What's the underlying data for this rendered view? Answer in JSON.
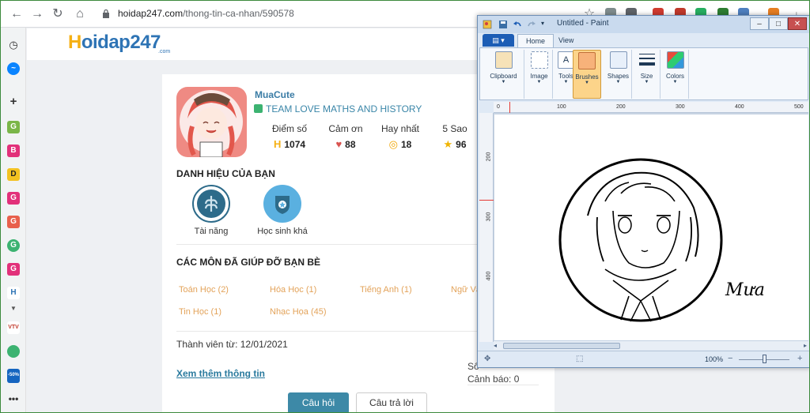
{
  "browser": {
    "url_domain": "hoidap247.com",
    "url_path": "/thong-tin-ca-nhan/590578"
  },
  "sidebar": {
    "items": [
      "G",
      "B",
      "D",
      "G",
      "G",
      "G",
      "G",
      "H"
    ],
    "vtv_label": "VTV",
    "sale_label": "-50%"
  },
  "site": {
    "logo_main": "oidap247",
    "logo_h": "H",
    "logo_com": ".com"
  },
  "profile": {
    "username": "MuaCute",
    "team": "TEAM LOVE MATHS AND HISTORY",
    "stats": [
      {
        "label": "Điểm số",
        "value": "1074",
        "icon": "hoidap-h-icon"
      },
      {
        "label": "Cảm ơn",
        "value": "88",
        "icon": "heart-icon"
      },
      {
        "label": "Hay nhất",
        "value": "18",
        "icon": "medal-icon"
      },
      {
        "label": "5 Sao",
        "value": "96",
        "icon": "star-icon"
      }
    ],
    "badges_title": "DANH HIỆU CỦA BẠN",
    "badges": [
      {
        "label": "Tài năng"
      },
      {
        "label": "Học sinh khá"
      }
    ],
    "subjects_title": "CÁC MÔN ĐÃ GIÚP ĐỠ BẠN BÈ",
    "subjects": [
      "Toán Học (2)",
      "Hóa Học (1)",
      "Tiếng Anh (1)",
      "Ngữ Vă",
      "Tin Học (1)",
      "Nhạc Họa (45)"
    ],
    "member_since": "Thành viên từ: 12/01/2021",
    "more_info": "Xem thêm thông tin",
    "right_cut": "Sô",
    "warning": "Cảnh báo: 0",
    "btn_questions": "Câu hỏi",
    "btn_answers": "Câu trả lời"
  },
  "paint": {
    "title": "Untitled - Paint",
    "tabs": [
      "Home",
      "View"
    ],
    "ribbon": [
      "Clipboard",
      "Image",
      "Tools",
      "Brushes",
      "Shapes",
      "Size",
      "Colors"
    ],
    "ruler_h": [
      "0",
      "100",
      "200",
      "300",
      "400",
      "500"
    ],
    "ruler_v": [
      "200",
      "300",
      "400"
    ],
    "signature": "Mưa",
    "zoom": "100%",
    "zoom_minus": "−",
    "zoom_plus": "+"
  }
}
